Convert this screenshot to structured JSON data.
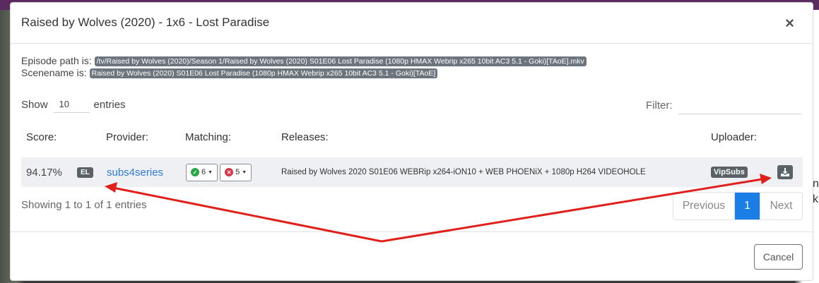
{
  "modal": {
    "title": "Raised by Wolves (2020) - 1x6 - Lost Paradise",
    "close_symbol": "×"
  },
  "paths": {
    "episode_label": "Episode path is:",
    "episode_value": "/tv/Raised by Wolves (2020)/Season 1/Raised by Wolves (2020) S01E06 Lost Paradise (1080p HMAX Webrip x265 10bit AC3 5.1 - Goki)[TAoE].mkv",
    "scene_label": "Scenename is:",
    "scene_value": "Raised by Wolves (2020) S01E06 Lost Paradise (1080p HMAX Webrip x265 10bit AC3 5.1 - Goki)[TAoE]"
  },
  "table_controls": {
    "show_label": "Show",
    "entries_value": "10",
    "entries_label": "entries",
    "filter_label": "Filter:",
    "filter_value": ""
  },
  "table": {
    "headers": {
      "score": "Score:",
      "provider": "Provider:",
      "matching": "Matching:",
      "releases": "Releases:",
      "uploader": "Uploader:"
    },
    "rows": [
      {
        "score": "94.17%",
        "language": "EL",
        "provider": "subs4series",
        "matches": "6",
        "mismatches": "5",
        "release": "Raised by Wolves 2020 S01E06 WEBRip x264-iON10 + WEB PHOENiX + 1080p H264 VIDEOHOLE",
        "uploader": "VipSubs"
      }
    ]
  },
  "footer": {
    "showing": "Showing 1 to 1 of 1 entries",
    "prev": "Previous",
    "current_page": "1",
    "next": "Next",
    "cancel": "Cancel"
  },
  "background": {
    "right_text_1": "n",
    "right_text_2": "k"
  },
  "colors": {
    "accent": "#1a7ee6",
    "annotation_arrow": "#e0201a"
  }
}
